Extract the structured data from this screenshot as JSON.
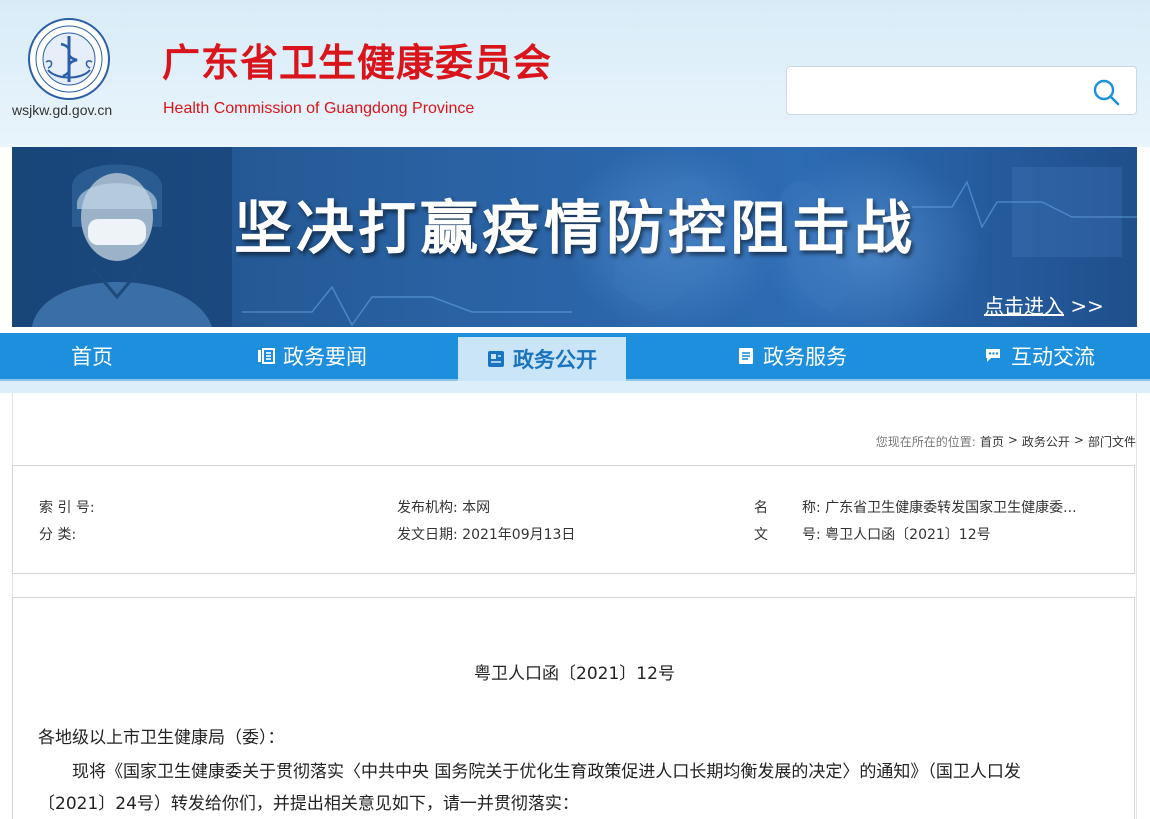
{
  "header": {
    "domain": "wsjkw.gd.gov.cn",
    "title": "广东省卫生健康委员会",
    "subtitle": "Health Commission of Guangdong Province",
    "search": {
      "value": "",
      "placeholder": ""
    }
  },
  "banner": {
    "slogan": "坚决打赢疫情防控阻击战",
    "enter_label": "点击进入",
    "enter_arrow": ">>"
  },
  "nav": {
    "items": [
      {
        "label": "首页",
        "icon": ""
      },
      {
        "label": "政务要闻",
        "icon": "news-icon"
      },
      {
        "label": "政务公开",
        "icon": "open-gov-icon",
        "active": true
      },
      {
        "label": "政务服务",
        "icon": "service-icon"
      },
      {
        "label": "互动交流",
        "icon": "chat-icon"
      }
    ]
  },
  "breadcrumb": {
    "prefix": "您现在所在的位置:",
    "items": [
      "首页",
      "政务公开",
      "部门文件"
    ],
    "separator": ">"
  },
  "meta": {
    "index_label": "索 引 号:",
    "index_value": "",
    "category_label": "分 类:",
    "category_value": "",
    "issuer_label": "发布机构:",
    "issuer_value": "本网",
    "date_label": "发文日期:",
    "date_value": "2021年09月13日",
    "name_label_a": "名",
    "name_label_b": "称:",
    "name_value": "广东省卫生健康委转发国家卫生健康委...",
    "docno_label_a": "文",
    "docno_label_b": "号:",
    "docno_value": "粤卫人口函〔2021〕12号"
  },
  "content": {
    "doc_number": "粤卫人口函〔2021〕12号",
    "salutation": "各地级以上市卫生健康局（委）：",
    "para1_line1": "现将《国家卫生健康委关于贯彻落实〈中共中央 国务院关于优化生育政策促进人口长期均衡发展的决定〉的通知》（国卫人口发",
    "para1_line2": "〔2021〕24号）转发给你们，并提出相关意见如下，请一并贯彻落实："
  },
  "colors": {
    "title_red": "#d9151b",
    "nav_blue": "#1d8fdc",
    "nav_active_bg": "#c9e5f7",
    "banner_blue": "#2a62a3"
  }
}
